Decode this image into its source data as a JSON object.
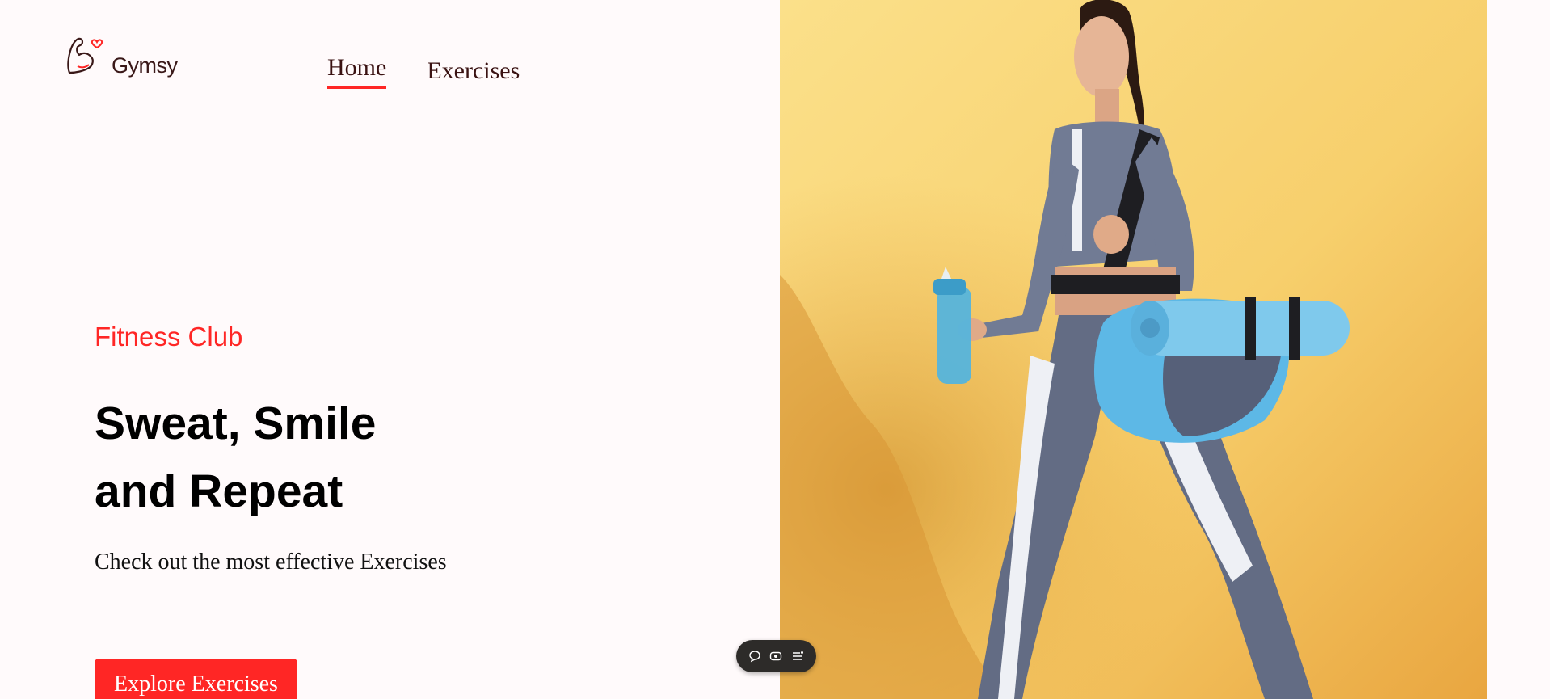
{
  "brand": {
    "name": "Gymsy",
    "logo_icon": "flexed-arm-heart-icon"
  },
  "nav": {
    "items": [
      {
        "label": "Home",
        "active": true
      },
      {
        "label": "Exercises",
        "active": false
      }
    ]
  },
  "hero": {
    "subtitle": "Fitness Club",
    "headline_line1": "Sweat, Smile",
    "headline_line2": "and Repeat",
    "tagline": "Check out the most effective Exercises",
    "cta_label": "Explore Exercises",
    "image_icon": "woman-with-gym-bag-photo"
  },
  "toolbar": {
    "icons": [
      "comment-icon",
      "eye-icon",
      "list-icon"
    ]
  },
  "colors": {
    "accent": "#ff2625",
    "background": "#fffafb",
    "hero_bg": "#f6c767",
    "toolbar_bg": "#2d2b29"
  }
}
